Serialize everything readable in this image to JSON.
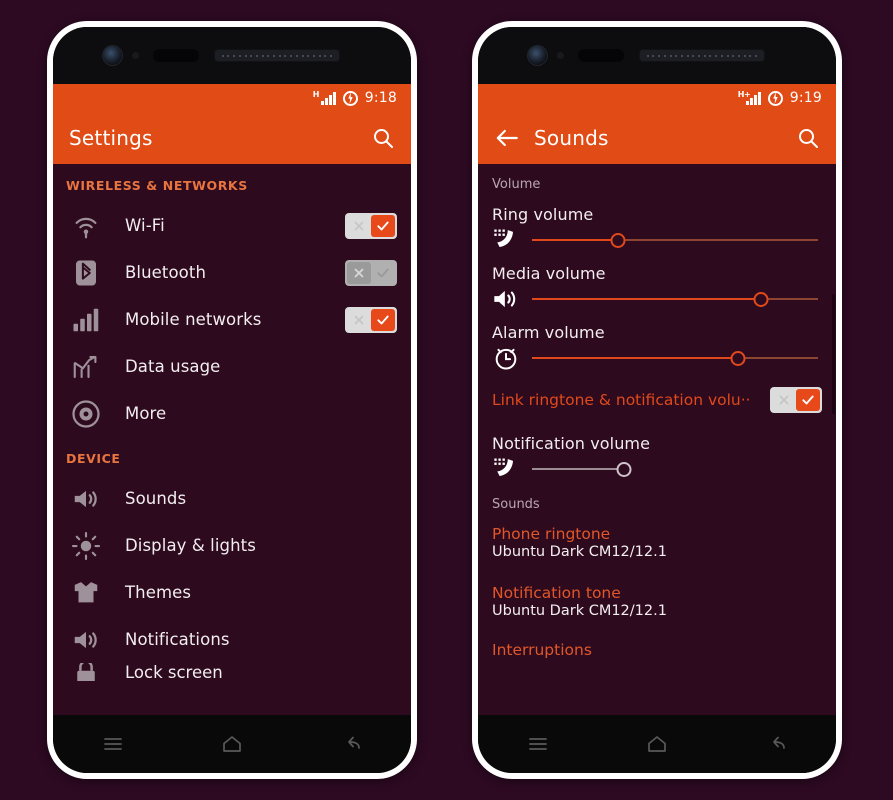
{
  "theme": {
    "accent_orange": "#e04b16",
    "content_bg": "#2e0a1e",
    "page_bg": "#2d0a22",
    "label_color": "#f2eef0",
    "section_header_color": "#e8743f"
  },
  "phone_left": {
    "status_bar": {
      "signal": "H",
      "battery": "charging",
      "time": "9:18"
    },
    "appbar": {
      "title": "Settings",
      "search_icon": "search-icon"
    },
    "sections": [
      {
        "header": "WIRELESS & NETWORKS",
        "items": [
          {
            "label": "Wi-Fi",
            "icon": "wifi-icon",
            "toggle": "on"
          },
          {
            "label": "Bluetooth",
            "icon": "bluetooth-icon",
            "toggle": "off"
          },
          {
            "label": "Mobile networks",
            "icon": "signal-bars-icon",
            "toggle": "on"
          },
          {
            "label": "Data usage",
            "icon": "data-usage-icon",
            "toggle": null
          },
          {
            "label": "More",
            "icon": "gear-icon",
            "toggle": null
          }
        ]
      },
      {
        "header": "DEVICE",
        "items": [
          {
            "label": "Sounds",
            "icon": "speaker-icon",
            "toggle": null
          },
          {
            "label": "Display & lights",
            "icon": "brightness-icon",
            "toggle": null
          },
          {
            "label": "Themes",
            "icon": "tshirt-icon",
            "toggle": null
          },
          {
            "label": "Notifications",
            "icon": "speaker-icon",
            "toggle": null
          }
        ]
      }
    ],
    "partial_item": {
      "label": "Lock screen",
      "icon": "lock-icon"
    },
    "navbar": [
      {
        "name": "menu-button",
        "icon": "menu-icon"
      },
      {
        "name": "home-button",
        "icon": "home-icon"
      },
      {
        "name": "back-button",
        "icon": "back-arrow-icon"
      }
    ]
  },
  "phone_right": {
    "status_bar": {
      "signal": "H+",
      "battery": "charging",
      "time": "9:19"
    },
    "appbar": {
      "back_icon": "back-arrow-icon",
      "title": "Sounds",
      "search_icon": "search-icon"
    },
    "volume_section": {
      "header": "Volume",
      "sliders": [
        {
          "label": "Ring volume",
          "icon": "ringtone-phone-icon",
          "value": 30,
          "enabled": true
        },
        {
          "label": "Media volume",
          "icon": "speaker-icon",
          "value": 80,
          "enabled": true
        },
        {
          "label": "Alarm volume",
          "icon": "clock-icon",
          "value": 72,
          "enabled": true
        },
        {
          "label": "Notification volume",
          "icon": "ringtone-phone-icon",
          "value": 32,
          "enabled": false
        }
      ],
      "link_row": {
        "label": "Link ringtone & notification volu··",
        "toggle": "on"
      }
    },
    "sounds_section": {
      "header": "Sounds",
      "items": [
        {
          "name": "Phone ringtone",
          "value": "Ubuntu Dark CM12/12.1"
        },
        {
          "name": "Notification tone",
          "value": "Ubuntu Dark CM12/12.1"
        }
      ],
      "interruptions": "Interruptions"
    },
    "navbar": [
      {
        "name": "menu-button",
        "icon": "menu-icon"
      },
      {
        "name": "home-button",
        "icon": "home-icon"
      },
      {
        "name": "back-button",
        "icon": "back-arrow-icon"
      }
    ]
  }
}
